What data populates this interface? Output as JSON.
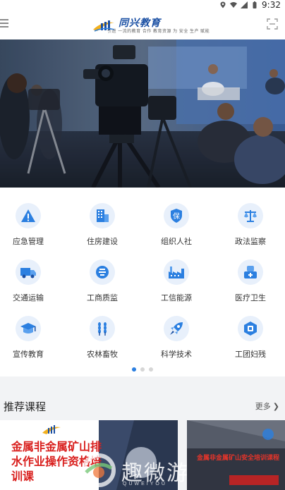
{
  "status_bar": {
    "time": "9:32"
  },
  "header": {
    "logo_title": "同兴教育",
    "logo_tagline": "引进 一流的教育 合作 教育资源 为 安全 生产 赋能"
  },
  "grid": {
    "items": [
      {
        "label": "应急管理",
        "icon": "warning-icon"
      },
      {
        "label": "住房建设",
        "icon": "building-icon"
      },
      {
        "label": "组织人社",
        "icon": "shield-bao-icon"
      },
      {
        "label": "政法监察",
        "icon": "scales-icon"
      },
      {
        "label": "交通运输",
        "icon": "truck-icon"
      },
      {
        "label": "工商质监",
        "icon": "emblem-icon"
      },
      {
        "label": "工信能源",
        "icon": "factory-icon"
      },
      {
        "label": "医疗卫生",
        "icon": "medical-icon"
      },
      {
        "label": "宣传教育",
        "icon": "graduation-cap-icon"
      },
      {
        "label": "农林畜牧",
        "icon": "wheat-icon"
      },
      {
        "label": "科学技术",
        "icon": "rocket-icon"
      },
      {
        "label": "工团妇残",
        "icon": "badge-icon"
      }
    ],
    "pager": {
      "count": 3,
      "active": 0
    }
  },
  "recommended": {
    "title": "推荐课程",
    "more": "更多",
    "courses": [
      {
        "title": "金属非金属矿山排水作业操作资格培训课"
      },
      {
        "title": "金属非金属矿山安全培训课程"
      }
    ]
  },
  "watermark": {
    "text": "趣微游",
    "sub": "QUWEIYOU"
  },
  "colors": {
    "accent": "#2b7fe0",
    "icon_bg": "#e8f0fb",
    "course_red": "#d9201e"
  }
}
